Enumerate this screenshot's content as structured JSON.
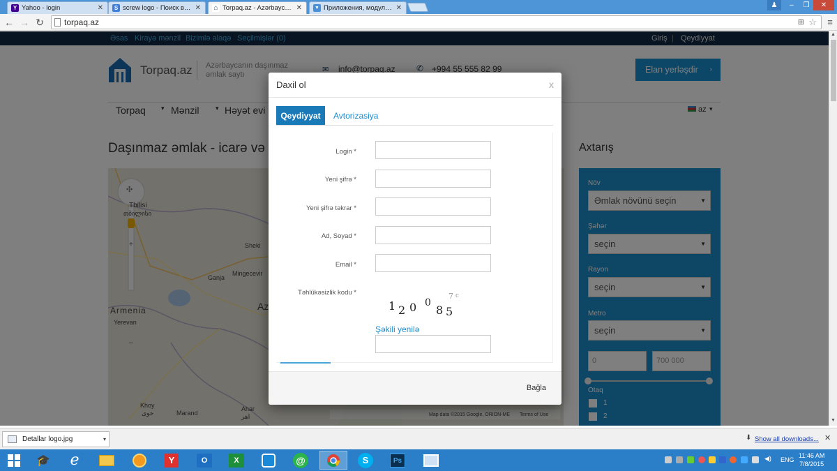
{
  "browser": {
    "tabs": [
      {
        "title": "Yahoo - login",
        "favicon": "Y",
        "color": "#400090",
        "active": false
      },
      {
        "title": "screw logo - Поиск в Goo",
        "favicon": "S",
        "color": "#3d7edb",
        "active": false
      },
      {
        "title": "Torpaq.az - Azərbaycanın",
        "favicon": "⌂",
        "color": "#1a5a8a",
        "active": true
      },
      {
        "title": "Приложения, модули, на",
        "favicon": "▼",
        "color": "#4a90d9",
        "active": false
      }
    ],
    "url": "torpaq.az",
    "window_controls": [
      "–",
      "❐",
      "✕"
    ]
  },
  "site": {
    "topnav_links": [
      "Əsas",
      "Kirayə mənzil",
      "Bizimlə əlaqə",
      "Seçilmişlər (0)"
    ],
    "topnav_right": [
      "Giriş",
      "|",
      "Qeydiyyat"
    ],
    "logo_text": "Torpaq.az",
    "tagline_1": "Azərbaycanın daşınmaz",
    "tagline_2": "əmlak saytı",
    "email": "info@torpaq.az",
    "phone": "+994 55 555 82 99",
    "post_button": "Elan yerləşdir",
    "menu": [
      "Torpaq",
      "Mənzil",
      "Həyət evi"
    ],
    "lang": "az",
    "heading": "Daşınmaz əmlak - icarə və",
    "search_heading": "Axtarış",
    "map_labels": {
      "tbilisi": "Tbilisi",
      "tbilisi_geo": "თბილისი",
      "sheki": "Sheki",
      "ganja": "Ganja",
      "mingecevir": "Mingecevir",
      "armenia": "Armenia",
      "yerevan": "Yerevan",
      "az": "Az",
      "khoy": "Khoy",
      "khoy_fa": "خوی",
      "marand": "Marand",
      "ahar": "Ahar",
      "ahar_fa": "اهر",
      "credit": "Map data ©2015 Google, ORION-ME",
      "terms": "Terms of Use"
    },
    "sidebar": {
      "nov_label": "Növ",
      "nov_value": "Əmlak növünü seçin",
      "seher_label": "Şəhər",
      "seher_value": "seçin",
      "rayon_label": "Rayon",
      "rayon_value": "seçin",
      "metro_label": "Metro",
      "metro_value": "seçin",
      "price_min": "0",
      "price_max": "700 000",
      "otaq_label": "Otaq",
      "rooms": [
        "1",
        "2"
      ]
    }
  },
  "modal": {
    "title": "Daxil ol",
    "close": "x",
    "tab_register": "Qeydiyyat",
    "tab_login": "Avtorizasiya",
    "fields": [
      {
        "label": "Login *",
        "value": ""
      },
      {
        "label": "Yeni şifrə *",
        "value": ""
      },
      {
        "label": "Yeni şifrə təkrar *",
        "value": ""
      },
      {
        "label": "Ad, Soyad *",
        "value": ""
      },
      {
        "label": "Email *",
        "value": ""
      }
    ],
    "captcha_label": "Təhlükəsizlik kodu *",
    "captcha_text": "120085",
    "refresh_link": "Şəkili yenilə",
    "footer_button": "Bağla"
  },
  "downloads": {
    "file": "Detallar logo.jpg",
    "show_all": "Show all downloads...",
    "close": "✕"
  },
  "taskbar": {
    "lang": "ENG",
    "time": "11:46 AM",
    "date": "7/8/2015"
  }
}
